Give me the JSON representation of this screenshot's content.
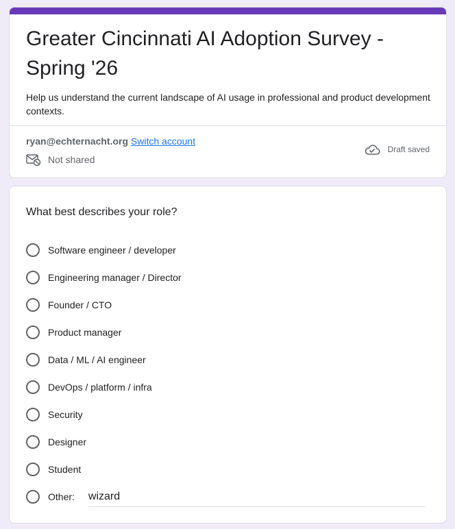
{
  "form": {
    "title": "Greater Cincinnati AI Adoption Survey - Spring '26",
    "description": "Help us understand the current landscape of AI usage in professional and product development contexts.",
    "accent_color": "#673ab7"
  },
  "account": {
    "email": "ryan@echternacht.org",
    "switch_label": "Switch account",
    "share_status": "Not shared",
    "share_icon": "mail-shared-icon",
    "save_status": "Draft saved",
    "save_icon": "cloud-done-icon"
  },
  "question": {
    "title": "What best describes your role?",
    "options": [
      {
        "label": "Software engineer / developer"
      },
      {
        "label": "Engineering manager / Director"
      },
      {
        "label": "Founder / CTO"
      },
      {
        "label": "Product manager"
      },
      {
        "label": "Data / ML / AI engineer"
      },
      {
        "label": "DevOps / platform / infra"
      },
      {
        "label": "Security"
      },
      {
        "label": "Designer"
      },
      {
        "label": "Student"
      }
    ],
    "other": {
      "label": "Other:",
      "value": "wizard"
    }
  }
}
